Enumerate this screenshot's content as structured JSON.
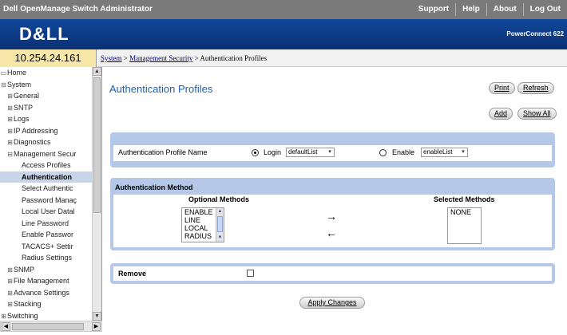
{
  "app_title": "Dell OpenManage Switch Administrator",
  "topnav": [
    "Support",
    "Help",
    "About",
    "Log Out"
  ],
  "brand": {
    "logo": "D&LL",
    "product": "PowerConnect 622"
  },
  "ip_address": "10.254.24.161",
  "breadcrumb": {
    "part1": "System",
    "sep": " > ",
    "part2": "Management Security",
    "part3": "Authentication Profiles"
  },
  "tree": [
    {
      "label": "Home",
      "tw": "",
      "icon": "home"
    },
    {
      "label": "System",
      "tw": "⊟"
    },
    {
      "label": "General",
      "tw": "⊞"
    },
    {
      "label": "SNTP",
      "tw": "⊞"
    },
    {
      "label": "Logs",
      "tw": "⊞"
    },
    {
      "label": "IP Addressing",
      "tw": "⊞"
    },
    {
      "label": "Diagnostics",
      "tw": "⊞"
    },
    {
      "label": "Management Secur",
      "tw": "⊟"
    },
    {
      "label": "Access Profiles",
      "tw": ""
    },
    {
      "label": "Authentication",
      "tw": ""
    },
    {
      "label": "Select Authentic",
      "tw": ""
    },
    {
      "label": "Password Manaç",
      "tw": ""
    },
    {
      "label": "Local User Datal",
      "tw": ""
    },
    {
      "label": "Line Password",
      "tw": ""
    },
    {
      "label": "Enable Passwor",
      "tw": ""
    },
    {
      "label": "TACACS+ Settir",
      "tw": ""
    },
    {
      "label": "Radius Settings",
      "tw": ""
    },
    {
      "label": "SNMP",
      "tw": "⊞"
    },
    {
      "label": "File Management",
      "tw": "⊞"
    },
    {
      "label": "Advance Settings",
      "tw": "⊞"
    },
    {
      "label": "Stacking",
      "tw": "⊞"
    },
    {
      "label": "Switching",
      "tw": "⊞"
    }
  ],
  "page_title": "Authentication Profiles",
  "buttons": {
    "print": "Print",
    "refresh": "Refresh",
    "add": "Add",
    "show_all": "Show All",
    "apply": "Apply Changes"
  },
  "profile": {
    "label": "Authentication Profile Name",
    "login_label": "Login",
    "login_value": "defaultList",
    "login_selected": true,
    "enable_label": "Enable",
    "enable_value": "enableList",
    "enable_selected": false
  },
  "method": {
    "heading": "Authentication Method",
    "optional_header": "Optional Methods",
    "selected_header": "Selected Methods",
    "optional": [
      "ENABLE",
      "LINE",
      "LOCAL",
      "RADIUS"
    ],
    "selected": [
      "NONE"
    ],
    "add_arrow": "→",
    "remove_arrow": "←"
  },
  "remove": {
    "label": "Remove",
    "checked": false
  },
  "colors": {
    "topbar": "#7a7a7a",
    "brand": "#0b3a82",
    "panel": "#b5c8e8",
    "title": "#1f5fae",
    "ip_bg": "#f6e7a8"
  }
}
